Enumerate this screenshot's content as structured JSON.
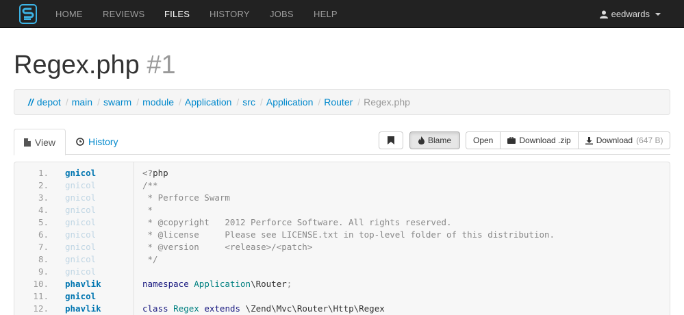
{
  "nav": {
    "items": [
      "HOME",
      "REVIEWS",
      "FILES",
      "HISTORY",
      "JOBS",
      "HELP"
    ],
    "active": "FILES",
    "user": "eedwards"
  },
  "title": {
    "name": "Regex.php",
    "revision": "#1"
  },
  "breadcrumb": {
    "root": "//",
    "items": [
      "depot",
      "main",
      "swarm",
      "module",
      "Application",
      "src",
      "Application",
      "Router"
    ],
    "current": "Regex.php",
    "separator": "/"
  },
  "tabs": {
    "view": "View",
    "history": "History"
  },
  "toolbar": {
    "blame": "Blame",
    "open": "Open",
    "download_zip": "Download .zip",
    "download": "Download",
    "download_size": "(647 B)"
  },
  "code": {
    "lines": [
      {
        "n": "1.",
        "author": "gnicol",
        "strong": true,
        "text": "<?php"
      },
      {
        "n": "2.",
        "author": "gnicol",
        "strong": false,
        "text": "/**"
      },
      {
        "n": "3.",
        "author": "gnicol",
        "strong": false,
        "text": " * Perforce Swarm"
      },
      {
        "n": "4.",
        "author": "gnicol",
        "strong": false,
        "text": " *"
      },
      {
        "n": "5.",
        "author": "gnicol",
        "strong": false,
        "text": " * @copyright   2012 Perforce Software. All rights reserved."
      },
      {
        "n": "6.",
        "author": "gnicol",
        "strong": false,
        "text": " * @license     Please see LICENSE.txt in top-level folder of this distribution."
      },
      {
        "n": "7.",
        "author": "gnicol",
        "strong": false,
        "text": " * @version     <release>/<patch>"
      },
      {
        "n": "8.",
        "author": "gnicol",
        "strong": false,
        "text": " */"
      },
      {
        "n": "9.",
        "author": "gnicol",
        "strong": false,
        "text": ""
      },
      {
        "n": "10.",
        "author": "phavlik",
        "strong": true,
        "text": "namespace Application\\Router;"
      },
      {
        "n": "11.",
        "author": "gnicol",
        "strong": true,
        "text": ""
      },
      {
        "n": "12.",
        "author": "phavlik",
        "strong": true,
        "text": "class Regex extends \\Zend\\Mvc\\Router\\Http\\Regex"
      }
    ]
  },
  "colors": {
    "navbar": "#222222",
    "link": "#0088cc",
    "author_strong": "#0075b0"
  }
}
